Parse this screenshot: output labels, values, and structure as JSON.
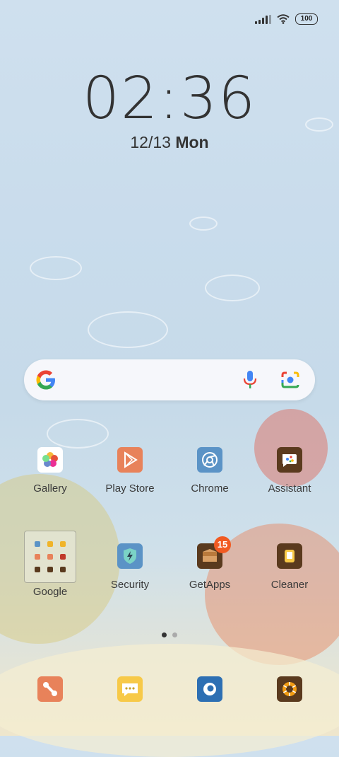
{
  "status_bar": {
    "battery": "100"
  },
  "lockclock": {
    "time": "02:36",
    "date": "12/13",
    "weekday": "Mon"
  },
  "colors": {
    "accent": "#f15a22",
    "play_store": "#e8825a",
    "chrome": "#5b93c6",
    "assistant": "#5a3a1e"
  },
  "home": {
    "row1": [
      {
        "label": "Gallery",
        "icon": "gallery-icon"
      },
      {
        "label": "Play Store",
        "icon": "play-store-icon"
      },
      {
        "label": "Chrome",
        "icon": "chrome-icon"
      },
      {
        "label": "Assistant",
        "icon": "assistant-icon"
      }
    ],
    "row2": [
      {
        "label": "Google",
        "icon": "folder-icon"
      },
      {
        "label": "Security",
        "icon": "security-icon"
      },
      {
        "label": "GetApps",
        "icon": "getapps-icon",
        "badge": "15"
      },
      {
        "label": "Cleaner",
        "icon": "cleaner-icon"
      }
    ]
  },
  "dock": [
    {
      "icon": "share-icon"
    },
    {
      "icon": "messaging-icon"
    },
    {
      "icon": "browser-icon"
    },
    {
      "icon": "camera-icon"
    }
  ],
  "page_indicator": {
    "pages": 2,
    "current": 1
  }
}
